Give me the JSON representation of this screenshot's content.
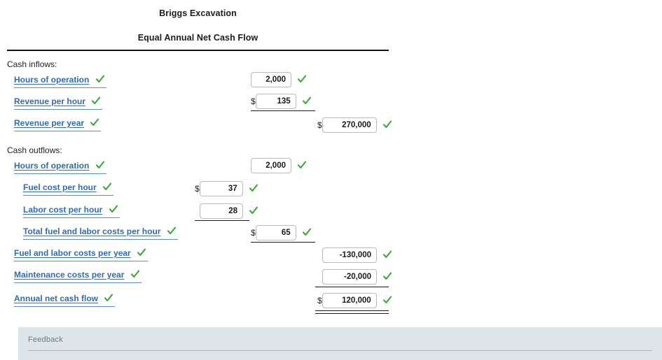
{
  "worksheet": {
    "company": "Briggs Excavation",
    "statement": "Equal Annual Net Cash Flow",
    "inflows_heading": "Cash inflows:",
    "outflows_heading": "Cash outflows:",
    "accent_label_color": "#2f6cb5",
    "check_color": "#3aa93a",
    "currency_symbol": "$",
    "rows": [
      {
        "label": "Hours of operation",
        "value": "2,000",
        "column": "col-b",
        "indent": 1,
        "currency": false,
        "label_checked": true,
        "value_checked": true
      },
      {
        "label": "Revenue per hour",
        "value": "135",
        "column": "col-b",
        "indent": 1,
        "currency": true,
        "label_checked": true,
        "value_checked": true
      },
      {
        "label": "Revenue per year",
        "value": "270,000",
        "column": "col-c",
        "indent": 1,
        "currency": true,
        "label_checked": true,
        "value_checked": true
      },
      {
        "label": "Hours of operation",
        "value": "2,000",
        "column": "col-b",
        "indent": 1,
        "currency": false,
        "label_checked": true,
        "value_checked": true
      },
      {
        "label": "Fuel cost per hour",
        "value": "37",
        "column": "col-a",
        "indent": 2,
        "currency": true,
        "label_checked": true,
        "value_checked": true
      },
      {
        "label": "Labor cost per hour",
        "value": "28",
        "column": "col-a",
        "indent": 2,
        "currency": false,
        "label_checked": true,
        "value_checked": true
      },
      {
        "label": "Total fuel and labor costs per hour",
        "value": "65",
        "column": "col-b",
        "indent": 2,
        "currency": true,
        "label_checked": true,
        "value_checked": true
      },
      {
        "label": "Fuel and labor costs per year",
        "value": "-130,000",
        "column": "col-c",
        "indent": 1,
        "currency": false,
        "label_checked": true,
        "value_checked": true
      },
      {
        "label": "Maintenance costs per year",
        "value": "-20,000",
        "column": "col-c",
        "indent": 1,
        "currency": false,
        "label_checked": true,
        "value_checked": true
      },
      {
        "label": "Annual net cash flow",
        "value": "120,000",
        "column": "col-c",
        "indent": 1,
        "currency": true,
        "label_checked": true,
        "value_checked": true
      }
    ]
  },
  "feedback": {
    "label": "Feedback"
  }
}
